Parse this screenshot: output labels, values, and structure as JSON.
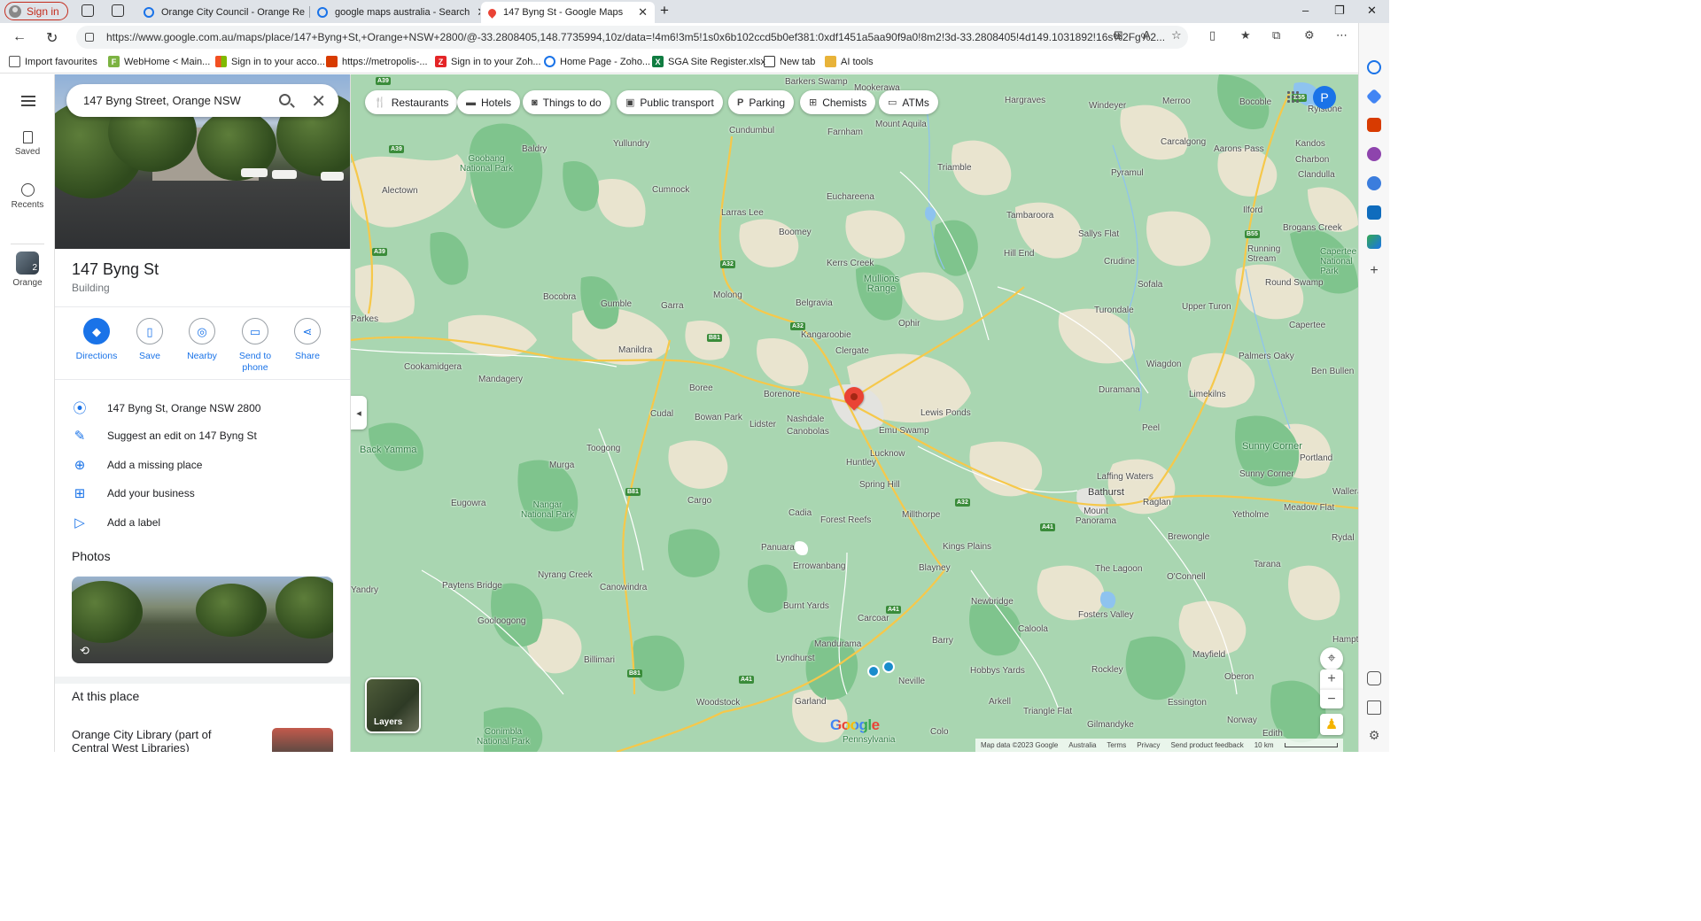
{
  "browser": {
    "signin_label": "Sign in",
    "tabs": [
      {
        "title": "Orange City Council - Orange Re",
        "active": false
      },
      {
        "title": "google maps australia - Search",
        "active": false
      },
      {
        "title": "147 Byng St - Google Maps",
        "active": true
      }
    ],
    "new_tab_label": "+",
    "window_controls": {
      "minimize": "–",
      "maximize": "❐",
      "close": "✕"
    },
    "url": "https://www.google.com.au/maps/place/147+Byng+St,+Orange+NSW+2800/@-33.2808405,148.7735994,10z/data=!4m6!3m5!1s0x6b102ccd5b0ef381:0xdf1451a5aa90f9a0!8m2!3d-33.2808405!4d149.1031892!16s%2Fg%2..."
  },
  "bookmarks": [
    {
      "label": "Import favourites",
      "icon": "import-icon",
      "color": "#555555"
    },
    {
      "label": "WebHome < Main...",
      "icon": "F",
      "color": "#7cb342"
    },
    {
      "label": "Sign in to your acco...",
      "icon": "microsoft-icon",
      "color": "#f25022"
    },
    {
      "label": "https://metropolis-...",
      "icon": "book-icon",
      "color": "#d83b01"
    },
    {
      "label": "Sign in to your Zoh...",
      "icon": "Z",
      "color": "#e42527"
    },
    {
      "label": "Home Page - Zoho...",
      "icon": "zoho-icon",
      "color": "#1a73e8"
    },
    {
      "label": "SGA Site Register.xlsx",
      "icon": "X",
      "color": "#107c41"
    },
    {
      "label": "New tab",
      "icon": "newtab-icon",
      "color": "#333333"
    },
    {
      "label": "AI tools",
      "icon": "folder-icon",
      "color": "#e8b339"
    }
  ],
  "rail": {
    "saved_label": "Saved",
    "recents_label": "Recents",
    "orange_label": "Orange",
    "orange_badge": "2"
  },
  "search": {
    "value": "147 Byng Street, Orange NSW"
  },
  "place": {
    "title": "147 Byng St",
    "type": "Building",
    "actions": [
      {
        "label": "Directions",
        "icon": "directions-icon"
      },
      {
        "label": "Save",
        "icon": "bookmark-icon"
      },
      {
        "label": "Nearby",
        "icon": "nearby-icon"
      },
      {
        "label": "Send to phone",
        "icon": "phone-icon"
      },
      {
        "label": "Share",
        "icon": "share-icon"
      }
    ],
    "info": [
      {
        "label": "147 Byng St, Orange NSW 2800",
        "icon": "location-pin-icon"
      },
      {
        "label": "Suggest an edit on 147 Byng St",
        "icon": "pencil-icon"
      },
      {
        "label": "Add a missing place",
        "icon": "add-place-icon"
      },
      {
        "label": "Add your business",
        "icon": "add-business-icon"
      },
      {
        "label": "Add a label",
        "icon": "label-icon"
      }
    ],
    "photos_title": "Photos",
    "at_this_place_title": "At this place",
    "library_title": "Orange City Library (part of Central West Libraries)"
  },
  "map": {
    "chips": [
      {
        "label": "Restaurants",
        "icon": "fork-knife-icon"
      },
      {
        "label": "Hotels",
        "icon": "bed-icon"
      },
      {
        "label": "Things to do",
        "icon": "camera-icon"
      },
      {
        "label": "Public transport",
        "icon": "bus-icon"
      },
      {
        "label": "Parking",
        "icon": "parking-icon"
      },
      {
        "label": "Chemists",
        "icon": "pharmacy-icon"
      },
      {
        "label": "ATMs",
        "icon": "atm-icon"
      }
    ],
    "avatar_letter": "P",
    "layers_label": "Layers",
    "google_logo": "Google",
    "footer": {
      "map_data": "Map data ©2023 Google",
      "country": "Australia",
      "terms": "Terms",
      "privacy": "Privacy",
      "feedback": "Send product feedback",
      "scale": "10 km"
    },
    "places": [
      {
        "name": "Baldry"
      },
      {
        "name": "Yullundry"
      },
      {
        "name": "Cundumbul"
      },
      {
        "name": "Goobang National Park",
        "park": true
      },
      {
        "name": "Alectown"
      },
      {
        "name": "Cumnock"
      },
      {
        "name": "Larras Lee"
      },
      {
        "name": "Boomey"
      },
      {
        "name": "Bocobra"
      },
      {
        "name": "Gumble"
      },
      {
        "name": "Garra"
      },
      {
        "name": "Molong"
      },
      {
        "name": "Parkes"
      },
      {
        "name": "Cookamidgera"
      },
      {
        "name": "Mandagery"
      },
      {
        "name": "Manildra"
      },
      {
        "name": "Boree"
      },
      {
        "name": "Cudal"
      },
      {
        "name": "Bowan Park"
      },
      {
        "name": "Back Yamma",
        "park": true
      },
      {
        "name": "Toogong"
      },
      {
        "name": "Murga"
      },
      {
        "name": "Eugowra"
      },
      {
        "name": "Nangar National Park",
        "park": true
      },
      {
        "name": "Cargo"
      },
      {
        "name": "Nyrang Creek"
      },
      {
        "name": "Paytens Bridge"
      },
      {
        "name": "Canowindra"
      },
      {
        "name": "Gooloogong"
      },
      {
        "name": "Billimari"
      },
      {
        "name": "Woodstock"
      },
      {
        "name": "Conimbla National Park",
        "park": true
      },
      {
        "name": "Yandry"
      },
      {
        "name": "Barkers Swamp"
      },
      {
        "name": "Farnham"
      },
      {
        "name": "Mookerawa"
      },
      {
        "name": "Mount Aquila"
      },
      {
        "name": "Triamble"
      },
      {
        "name": "Euchareena"
      },
      {
        "name": "Kerrs Creek"
      },
      {
        "name": "Mullions Range",
        "park": true
      },
      {
        "name": "Belgravia"
      },
      {
        "name": "Kangaroobie"
      },
      {
        "name": "Ophir"
      },
      {
        "name": "Clergate"
      },
      {
        "name": "Borenore"
      },
      {
        "name": "Nashdale"
      },
      {
        "name": "Lidster"
      },
      {
        "name": "Canobolas"
      },
      {
        "name": "Lewis Ponds"
      },
      {
        "name": "Emu Swamp"
      },
      {
        "name": "Lucknow"
      },
      {
        "name": "Huntley"
      },
      {
        "name": "Spring Hill"
      },
      {
        "name": "Cadia"
      },
      {
        "name": "Forest Reefs"
      },
      {
        "name": "Millthorpe"
      },
      {
        "name": "Panuara"
      },
      {
        "name": "Errowanbang"
      },
      {
        "name": "Kings Plains"
      },
      {
        "name": "Blayney"
      },
      {
        "name": "Burnt Yards"
      },
      {
        "name": "Carcoar"
      },
      {
        "name": "Mandurama"
      },
      {
        "name": "Lyndhurst"
      },
      {
        "name": "Neville"
      },
      {
        "name": "Garland"
      },
      {
        "name": "Pennsylvania",
        "park": true
      },
      {
        "name": "Colo"
      },
      {
        "name": "Hargraves"
      },
      {
        "name": "Windeyer"
      },
      {
        "name": "Merroo"
      },
      {
        "name": "Bocoble"
      },
      {
        "name": "Rylstone"
      },
      {
        "name": "Carcalgong"
      },
      {
        "name": "Aarons Pass"
      },
      {
        "name": "Kandos"
      },
      {
        "name": "Charbon"
      },
      {
        "name": "Clandulla"
      },
      {
        "name": "Pyramul"
      },
      {
        "name": "Tambaroora"
      },
      {
        "name": "Ilford"
      },
      {
        "name": "Brogans Creek"
      },
      {
        "name": "Sallys Flat"
      },
      {
        "name": "Hill End"
      },
      {
        "name": "Crudine"
      },
      {
        "name": "Running Stream"
      },
      {
        "name": "Capertee National Park",
        "park": true
      },
      {
        "name": "Sofala"
      },
      {
        "name": "Round Swamp"
      },
      {
        "name": "Turondale"
      },
      {
        "name": "Upper Turon"
      },
      {
        "name": "Capertee"
      },
      {
        "name": "Palmers Oaky"
      },
      {
        "name": "Wiagdon"
      },
      {
        "name": "Ben Bullen"
      },
      {
        "name": "Duramana"
      },
      {
        "name": "Limekilns"
      },
      {
        "name": "Peel"
      },
      {
        "name": "Sunny Corner",
        "park": true
      },
      {
        "name": "Sunny Corner"
      },
      {
        "name": "Portland"
      },
      {
        "name": "Laffing Waters"
      },
      {
        "name": "Bathurst",
        "big": true
      },
      {
        "name": "Raglan"
      },
      {
        "name": "Mount Panorama"
      },
      {
        "name": "Yetholme"
      },
      {
        "name": "Meadow Flat"
      },
      {
        "name": "Wallerawang"
      },
      {
        "name": "Brewongle"
      },
      {
        "name": "Rydal"
      },
      {
        "name": "Tarana"
      },
      {
        "name": "The Lagoon"
      },
      {
        "name": "O'Connell"
      },
      {
        "name": "Newbridge"
      },
      {
        "name": "Fosters Valley"
      },
      {
        "name": "Barry"
      },
      {
        "name": "Caloola"
      },
      {
        "name": "Mayfield"
      },
      {
        "name": "Hampton"
      },
      {
        "name": "Hobbys Yards"
      },
      {
        "name": "Rockley"
      },
      {
        "name": "Oberon"
      },
      {
        "name": "Arkell"
      },
      {
        "name": "Essington"
      },
      {
        "name": "Triangle Flat"
      },
      {
        "name": "Gilmandyke"
      },
      {
        "name": "Norway"
      },
      {
        "name": "Edith"
      }
    ],
    "road_shields": [
      "A39",
      "A39",
      "A39",
      "A32",
      "A32",
      "A32",
      "B81",
      "B81",
      "B81",
      "A41",
      "A41",
      "A41",
      "B55",
      "B55"
    ]
  },
  "colors": {
    "accent": "#1a73e8",
    "pin": "#ea4335",
    "map_green": "#a9d6b1",
    "forest": "#7fc48d",
    "farmland": "#e9e4cf",
    "road": "#f6c84a"
  }
}
